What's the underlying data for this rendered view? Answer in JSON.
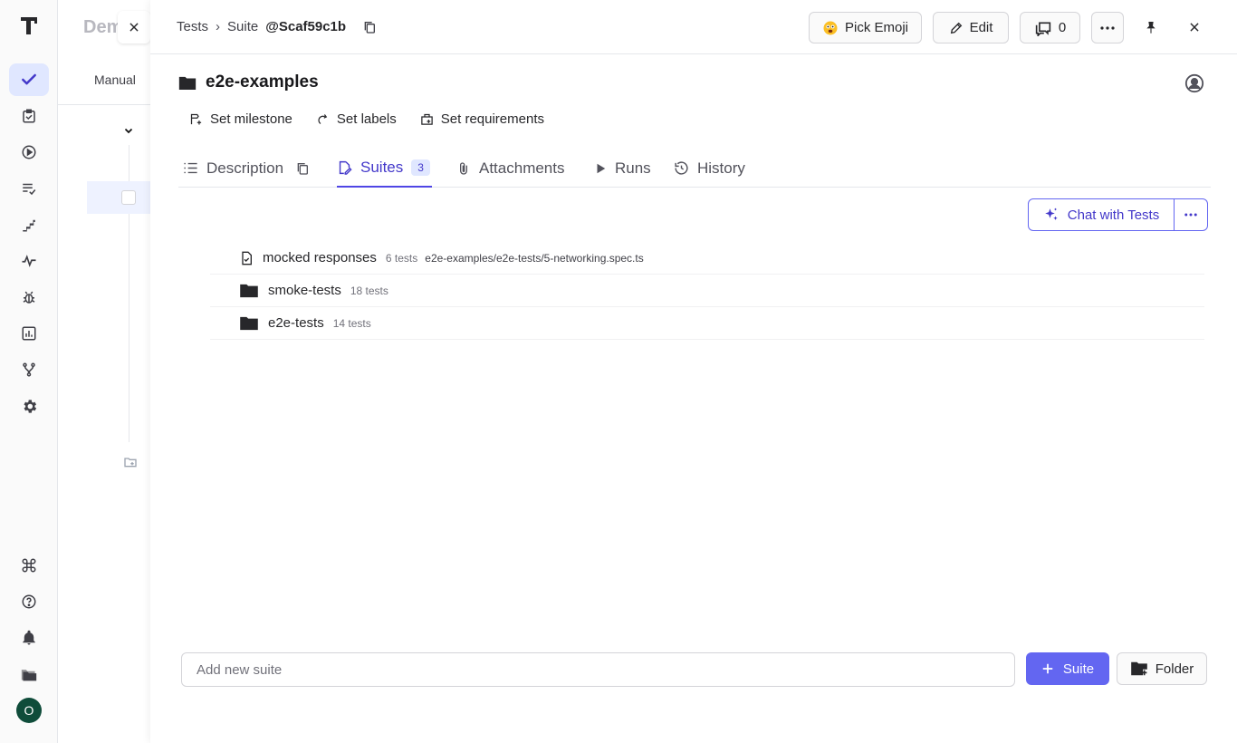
{
  "rail": {
    "items": [
      {
        "icon": "check-icon",
        "active": true
      },
      {
        "icon": "clipboard-check-icon"
      },
      {
        "icon": "play-circle-icon"
      },
      {
        "icon": "list-check-icon"
      },
      {
        "icon": "steps-icon"
      },
      {
        "icon": "pulse-icon"
      },
      {
        "icon": "bug-icon"
      },
      {
        "icon": "analytics-icon"
      },
      {
        "icon": "branch-icon"
      },
      {
        "icon": "gear-icon"
      },
      {
        "icon": "command-icon"
      },
      {
        "icon": "help-icon"
      },
      {
        "icon": "bell-icon"
      },
      {
        "icon": "projects-icon"
      }
    ],
    "avatar_initial": "O"
  },
  "background_page": {
    "title": "Dem",
    "tab_label": "Manual"
  },
  "breadcrumb": {
    "root": "Tests",
    "separator": "›",
    "current_prefix": "Suite",
    "current_id": "@Scaf59c1b"
  },
  "toolbar": {
    "emoji_label": "Pick Emoji",
    "edit_label": "Edit",
    "comments_count": "0"
  },
  "suite": {
    "title": "e2e-examples"
  },
  "meta_actions": {
    "milestone": "Set milestone",
    "labels": "Set labels",
    "requirements": "Set requirements"
  },
  "tabs": {
    "description": "Description",
    "suites": "Suites",
    "suites_count": "3",
    "attachments": "Attachments",
    "runs": "Runs",
    "history": "History"
  },
  "chat": {
    "label": "Chat with Tests"
  },
  "suites_list": [
    {
      "name": "mocked responses",
      "count": "6 tests",
      "path": "e2e-examples/e2e-tests/5-networking.spec.ts",
      "icon": "file-check-icon"
    },
    {
      "name": "smoke-tests",
      "count": "18 tests",
      "path": "",
      "icon": "folder-icon"
    },
    {
      "name": "e2e-tests",
      "count": "14 tests",
      "path": "",
      "icon": "folder-icon"
    }
  ],
  "bottom": {
    "input_placeholder": "Add new suite",
    "suite_button": "Suite",
    "folder_button": "Folder"
  },
  "colors": {
    "accent": "#6366f1",
    "accent_dark": "#4338ca"
  }
}
